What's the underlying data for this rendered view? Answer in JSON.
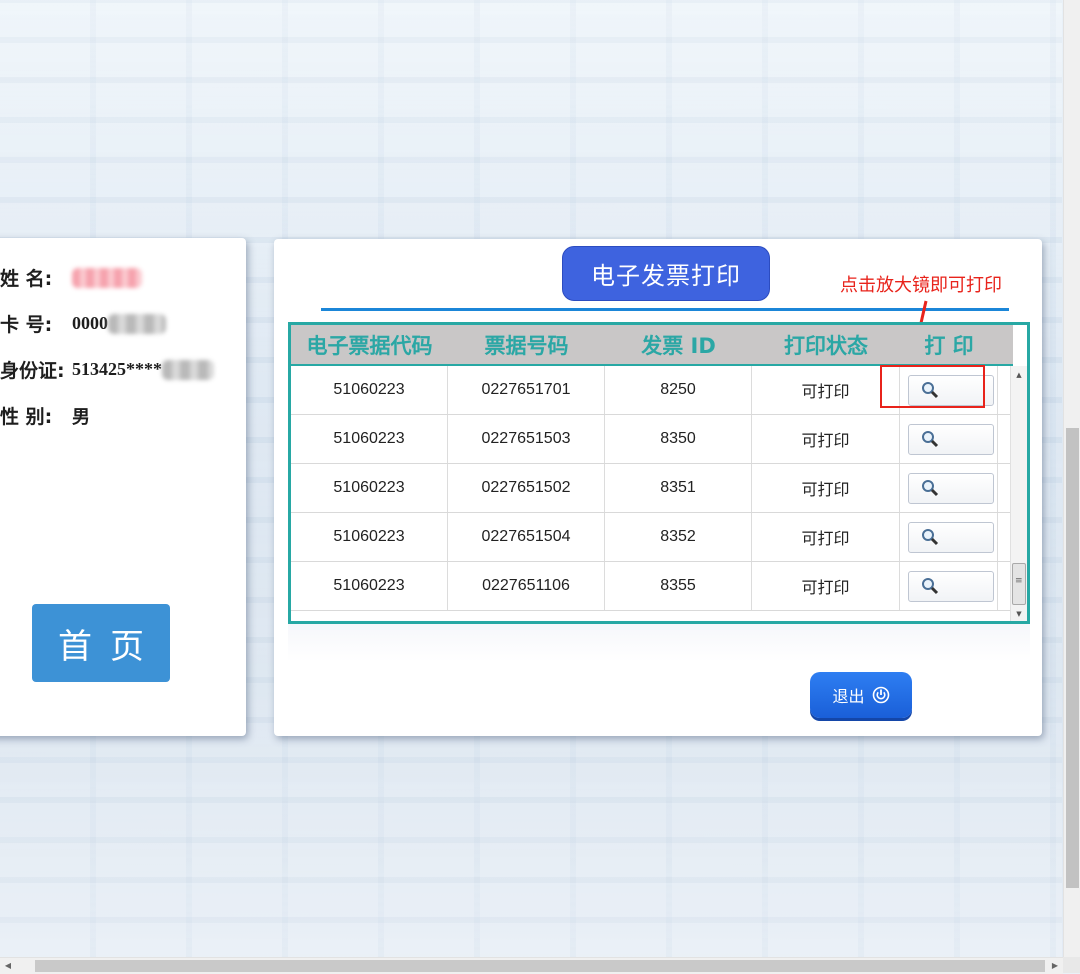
{
  "user_info": {
    "name": {
      "label": "姓 名:",
      "value": ""
    },
    "card": {
      "label": "卡 号:",
      "value": "0000"
    },
    "id_card": {
      "label": "身份证:",
      "value": "513425****"
    },
    "gender": {
      "label": "性 别:",
      "value": "男"
    }
  },
  "home_button": {
    "label": "首页"
  },
  "panel": {
    "title": "电子发票打印",
    "annotation": "点击放大镜即可打印"
  },
  "table": {
    "headers": [
      "电子票据代码",
      "票据号码",
      "发票 ID",
      "打印状态",
      "打 印"
    ],
    "rows": [
      {
        "code": "51060223",
        "number": "0227651701",
        "invoice_id": "8250",
        "status": "可打印"
      },
      {
        "code": "51060223",
        "number": "0227651503",
        "invoice_id": "8350",
        "status": "可打印"
      },
      {
        "code": "51060223",
        "number": "0227651502",
        "invoice_id": "8351",
        "status": "可打印"
      },
      {
        "code": "51060223",
        "number": "0227651504",
        "invoice_id": "8352",
        "status": "可打印"
      },
      {
        "code": "51060223",
        "number": "0227651106",
        "invoice_id": "8355",
        "status": "可打印"
      }
    ]
  },
  "exit_button": {
    "label": "退出"
  },
  "icons": {
    "print_action": "magnifier-icon",
    "exit": "power-icon",
    "annotation_arrow": "red-arrow-icon"
  },
  "colors": {
    "title_bg": "#3e63df",
    "table_accent": "#27a8a4",
    "annotation": "#e8231b",
    "home_button": "#3d92d6",
    "exit_button": "#1a5fd8"
  }
}
